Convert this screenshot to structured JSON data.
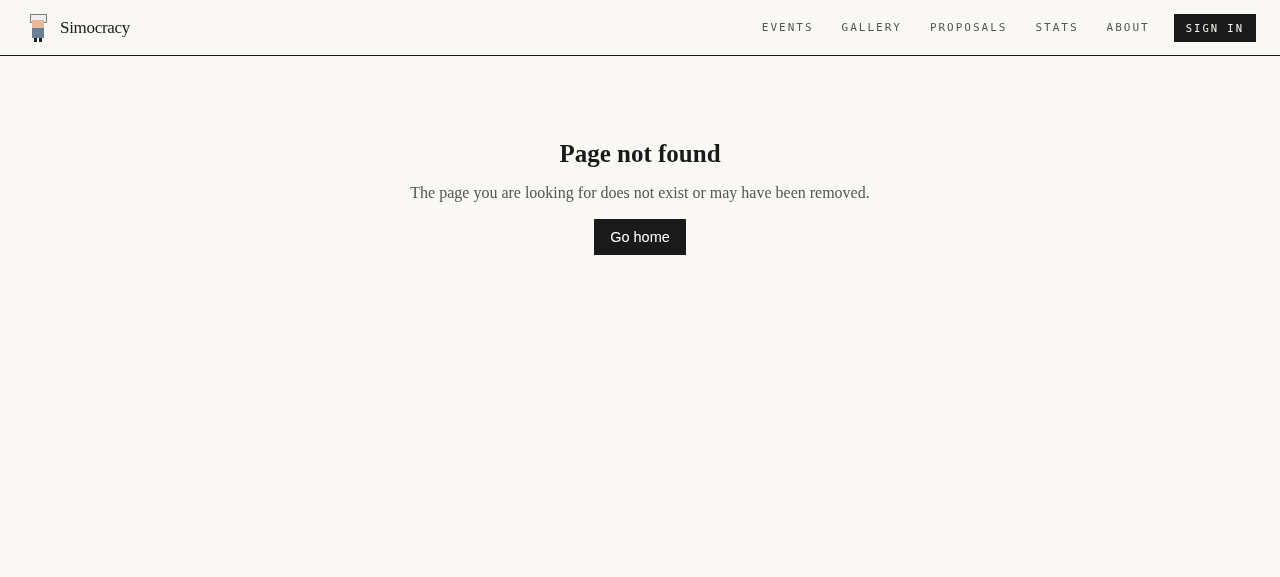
{
  "header": {
    "brand": "Simocracy",
    "nav": [
      "EVENTS",
      "GALLERY",
      "PROPOSALS",
      "STATS",
      "ABOUT"
    ],
    "sign_in": "SIGN IN"
  },
  "main": {
    "title": "Page not found",
    "message": "The page you are looking for does not exist or may have been removed.",
    "button": "Go home"
  }
}
